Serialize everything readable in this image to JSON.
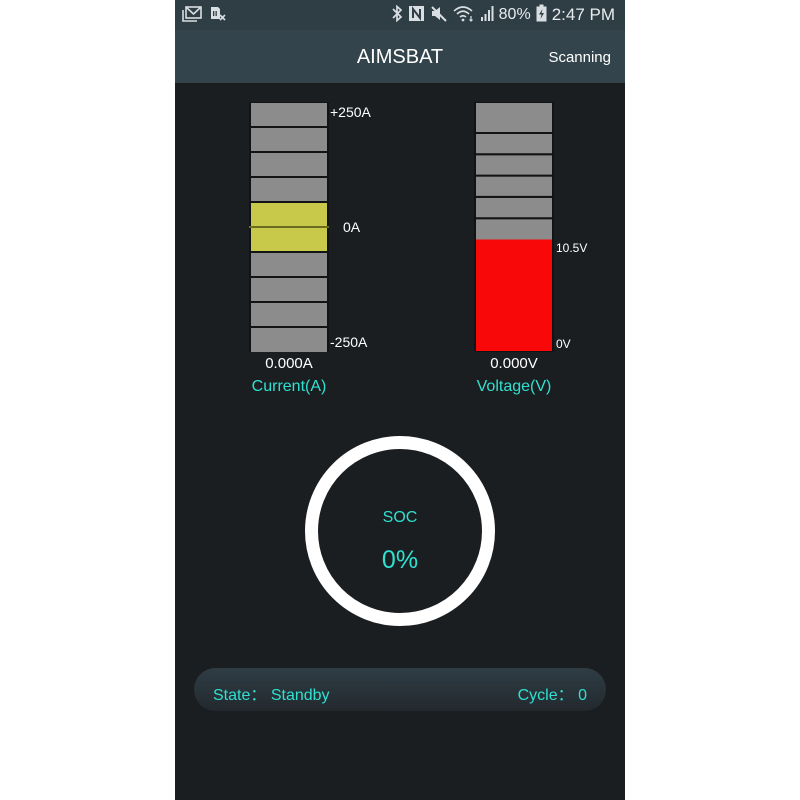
{
  "status_bar": {
    "left_icons": [
      "email-notification-icon",
      "no-sim-icon"
    ],
    "right_icons": [
      "bluetooth-icon",
      "nfc-icon",
      "mute-icon",
      "wifi-icon",
      "signal-icon",
      "battery-charging-icon"
    ],
    "battery_percent": "80%",
    "time": "2:47 PM"
  },
  "app_bar": {
    "title": "AIMSBAT",
    "action": "Scanning"
  },
  "current_gauge": {
    "max_label": "+250A",
    "mid_label": "0A",
    "min_label": "-250A",
    "reading": "0.000A",
    "caption": "Current(A)",
    "segments": 10,
    "highlighted_segments": [
      4,
      5
    ],
    "value_amps": 0,
    "range_amps": [
      -250,
      250
    ],
    "colors": {
      "segment": "#8c8c8c",
      "highlight": "#c8c84a"
    }
  },
  "voltage_gauge": {
    "threshold_label": "10.5V",
    "min_label": "0V",
    "reading": "0.000V",
    "caption": "Voltage(V)",
    "gray_segments": 6,
    "red_fraction_of_bar": 0.45,
    "colors": {
      "segment": "#8c8c8c",
      "alert": "#f80808"
    }
  },
  "soc": {
    "label": "SOC",
    "value": "0%",
    "percent": 0
  },
  "status_panel": {
    "state_label": "State：",
    "state_value": "Standby",
    "cycle_label": "Cycle：",
    "cycle_value": "0"
  },
  "colors": {
    "accent": "#2fe0d0",
    "background": "#1b1e21",
    "app_bar": "#33444c"
  }
}
